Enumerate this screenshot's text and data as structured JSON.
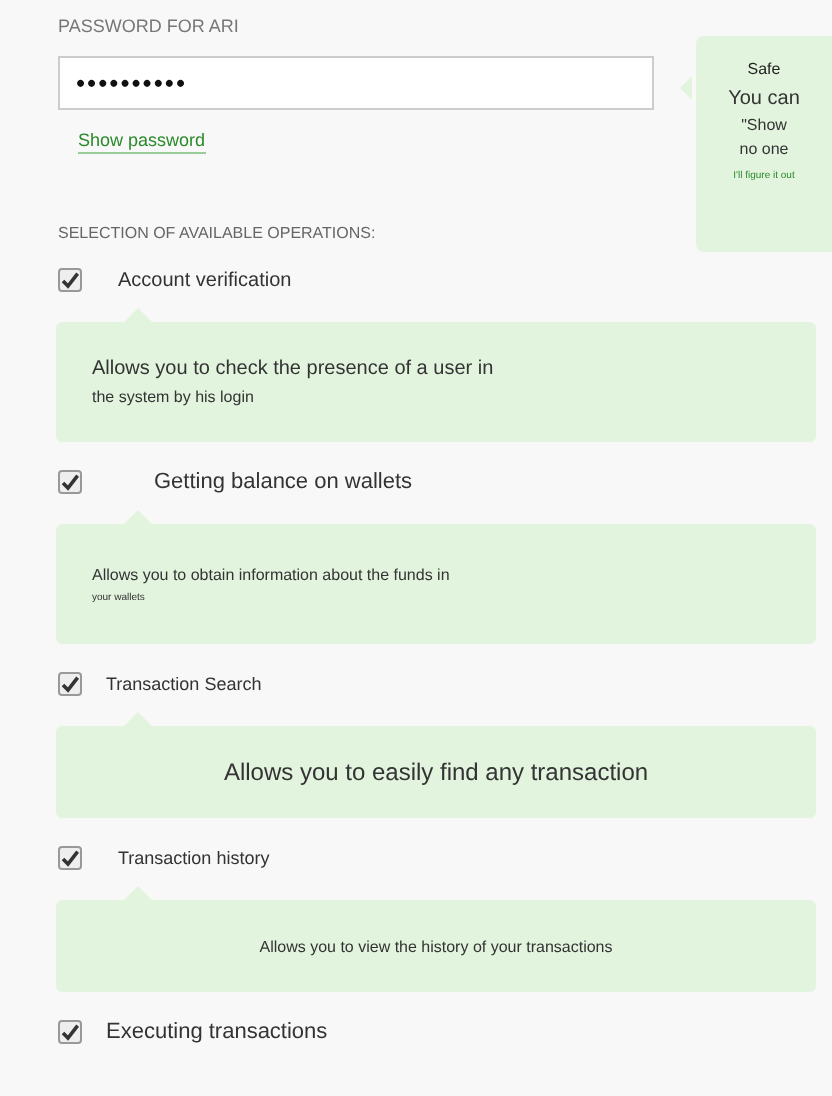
{
  "password": {
    "label": "PASSWORD FOR ARI",
    "value": "••••••••••",
    "show_link": "Show password"
  },
  "hint": {
    "title": "Safe",
    "lines": [
      "You can",
      "\"Show",
      "no one"
    ],
    "link": "I'll figure it out"
  },
  "operations_heading": "SELECTION OF AVAILABLE OPERATIONS:",
  "operations": [
    {
      "label": "Account verification",
      "checked": true,
      "description": [
        "Allows you to check the presence of a user in",
        "the system by his login"
      ]
    },
    {
      "label": "Getting balance on wallets",
      "checked": true,
      "description": [
        "Allows you to obtain information about the funds in",
        "your wallets"
      ]
    },
    {
      "label": "Transaction Search",
      "checked": true,
      "description": [
        "Allows you to easily find any transaction"
      ]
    },
    {
      "label": "Transaction history",
      "checked": true,
      "description": [
        "Allows you to view the history of your transactions"
      ]
    },
    {
      "label": "Executing transactions",
      "checked": true
    }
  ]
}
